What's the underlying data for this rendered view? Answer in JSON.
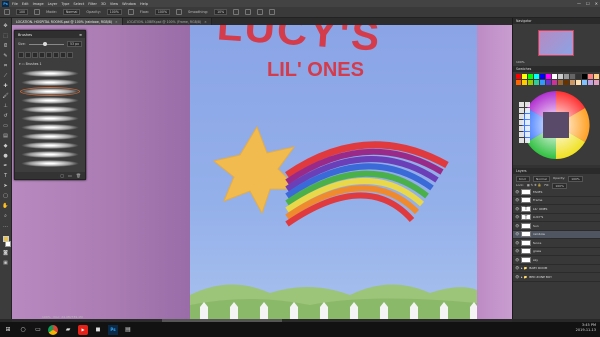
{
  "menu": {
    "logo": "Ps",
    "items": [
      "File",
      "Edit",
      "Image",
      "Layer",
      "Type",
      "Select",
      "Filter",
      "3D",
      "View",
      "Window",
      "Help"
    ],
    "window_controls": [
      "—",
      "☐",
      "✕"
    ]
  },
  "options": {
    "size": "100",
    "mode_label": "Mode:",
    "mode": "Normal",
    "opacity_label": "Opacity:",
    "opacity": "100%",
    "flow_label": "Flow:",
    "flow": "100%",
    "smoothing_label": "Smoothing:",
    "smoothing": "10%"
  },
  "tabs": [
    {
      "label": "LOCATION- HOSPITAL ROOMS.psd @ 100% (rainbow, RGB/8)",
      "active": true
    },
    {
      "label": "LOCATION- LOBBY.psd @ 100% (Frame, RGB/8)",
      "active": false
    }
  ],
  "canvas": {
    "title_main": "LUCY'S",
    "title_sub": "LIL' ONES"
  },
  "brushes_panel": {
    "title": "Brushes",
    "size_label": "Size:",
    "size_value": "53 px",
    "folder": "Brushes 1"
  },
  "navigator": {
    "title": "Navigator",
    "zoom": "100%"
  },
  "swatches": {
    "title": "Swatches",
    "colors": [
      "#ff0000",
      "#ffff00",
      "#00ff00",
      "#00ffff",
      "#0000ff",
      "#ff00ff",
      "#ffffff",
      "#cccccc",
      "#999999",
      "#666666",
      "#333333",
      "#000000",
      "#ff8080",
      "#ffcc80",
      "#ff6600",
      "#ffcc00",
      "#99cc00",
      "#33cc99",
      "#3399ff",
      "#6633cc",
      "#cc3399",
      "#996633",
      "#663300",
      "#cc9966",
      "#ffe0b0",
      "#80c0ff",
      "#c0a0e0",
      "#e0a0c0"
    ]
  },
  "layers": {
    "title": "Layers",
    "kind_label": "Kind",
    "blend": "Normal",
    "opacity_label": "Opacity:",
    "opacity": "100%",
    "lock_label": "Lock:",
    "fill_label": "Fill:",
    "fill": "100%",
    "rows": [
      {
        "name": "FACES",
        "type": "img",
        "selected": false
      },
      {
        "name": "Frame",
        "type": "img",
        "selected": false
      },
      {
        "name": "LIL' ONES",
        "type": "text",
        "selected": false
      },
      {
        "name": "LUCY'S",
        "type": "text",
        "selected": false
      },
      {
        "name": "Sun",
        "type": "img",
        "selected": false
      },
      {
        "name": "rainbow",
        "type": "img",
        "selected": true
      },
      {
        "name": "fence",
        "type": "img",
        "selected": false
      },
      {
        "name": "grass",
        "type": "img",
        "selected": false
      },
      {
        "name": "sky",
        "type": "img",
        "selected": false
      },
      {
        "name": "BABY ROOM",
        "type": "folder",
        "selected": false
      },
      {
        "name": "BED ZONE BOY",
        "type": "folder",
        "selected": false
      }
    ]
  },
  "status": {
    "zoom": "100%",
    "doc": "Doc: 24.9M/739.1M"
  },
  "taskbar": {
    "time": "3:45 PM",
    "date": "2019-11-13"
  }
}
